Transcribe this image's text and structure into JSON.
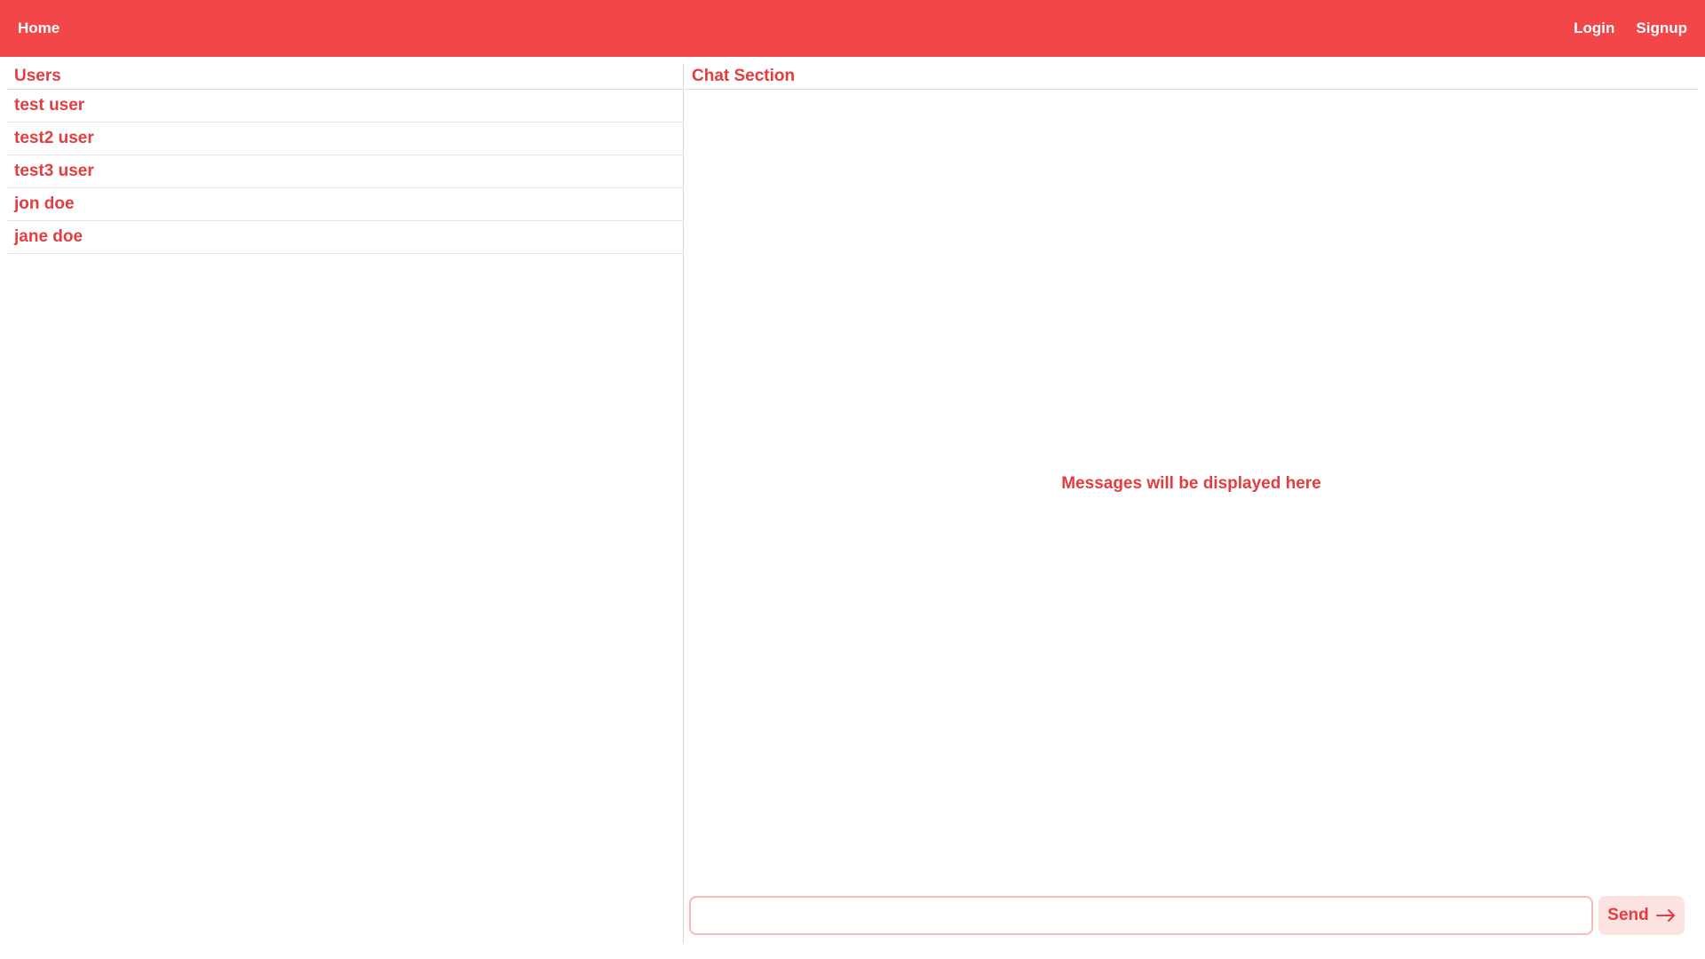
{
  "nav": {
    "home": "Home",
    "login": "Login",
    "signup": "Signup"
  },
  "users_panel": {
    "title": "Users",
    "users": [
      {
        "name": "test user"
      },
      {
        "name": "test2 user"
      },
      {
        "name": "test3 user"
      },
      {
        "name": "jon doe"
      },
      {
        "name": "jane doe"
      }
    ]
  },
  "chat_panel": {
    "title": "Chat Section",
    "empty_message": "Messages will be displayed here",
    "input_value": "",
    "send_label": "Send",
    "send_icon": "arrow-right-icon"
  },
  "colors": {
    "accent": "#f24648",
    "text_accent": "#e33d40",
    "send_bg": "#fde2e2",
    "input_border": "#f7b9ba"
  }
}
